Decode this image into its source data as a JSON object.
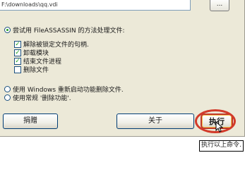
{
  "path": {
    "value": "F:\\downloads\\qq.vdi"
  },
  "browse_button": {
    "label": "..."
  },
  "options": {
    "fileassassin": {
      "label": "尝试用 FileASSASSIN 的方法处理文件:",
      "selected": true
    },
    "checks": [
      {
        "label": "解除被锁定文件的句柄.",
        "checked": true
      },
      {
        "label": "卸载模块",
        "checked": true
      },
      {
        "label": "结束文件进程",
        "checked": true
      },
      {
        "label": "删除文件",
        "checked": false
      }
    ],
    "windows_restart": {
      "label": "使用 Windows 重新启动功能删除文件.",
      "selected": false
    },
    "normal_delete": {
      "label": "使用常规 '删除功能'.",
      "selected": false
    }
  },
  "buttons": {
    "donate": "捐赠",
    "about": "关于",
    "execute": "执行"
  },
  "tooltip": {
    "text": "执行以上命令."
  },
  "colors": {
    "dialog_bg": "#ece9d8",
    "highlight_ring": "#d23a2a",
    "check_green": "#21a121"
  }
}
